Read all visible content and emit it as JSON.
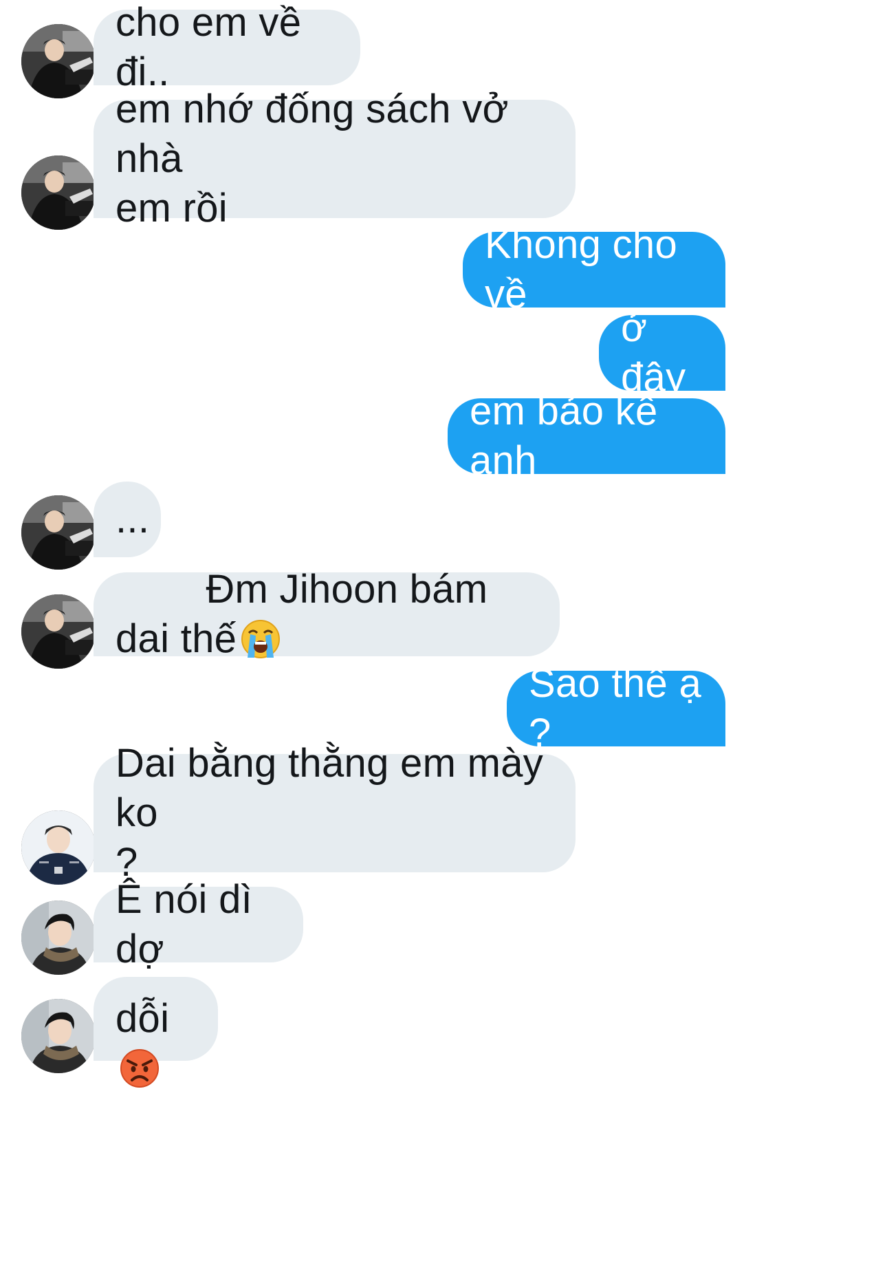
{
  "conversation": {
    "messages": [
      {
        "sender": "other",
        "avatar": "avatar-black-jacket",
        "text": "cho em về đi.."
      },
      {
        "sender": "other",
        "avatar": "avatar-black-jacket",
        "text": "em nhớ đống sách vở nhà\nem rồi"
      },
      {
        "sender": "me",
        "text": "Khong cho về"
      },
      {
        "sender": "me",
        "text": "ở đây"
      },
      {
        "sender": "me",
        "text": "em bảo kê anh"
      },
      {
        "sender": "other",
        "avatar": "avatar-black-jacket",
        "text": "..."
      },
      {
        "sender": "other",
        "avatar": "avatar-black-jacket",
        "text": "Đm Jihoon bám dai thế",
        "emoji": "loudly-crying-face-icon"
      },
      {
        "sender": "me",
        "text": "Sao thế ạ ?"
      },
      {
        "sender": "other",
        "avatar": "avatar-navy-hoodie",
        "text": "Dai bằng thằng em mày ko\n?"
      },
      {
        "sender": "other",
        "avatar": "avatar-scarf",
        "text": "Ê nói dì dợ"
      },
      {
        "sender": "other",
        "avatar": "avatar-scarf",
        "text": "dỗi",
        "emoji": "angry-face-icon"
      }
    ]
  },
  "colors": {
    "incoming_bubble": "#e6ecf0",
    "outgoing_bubble": "#1da1f2",
    "incoming_text": "#14171a",
    "outgoing_text": "#ffffff"
  }
}
